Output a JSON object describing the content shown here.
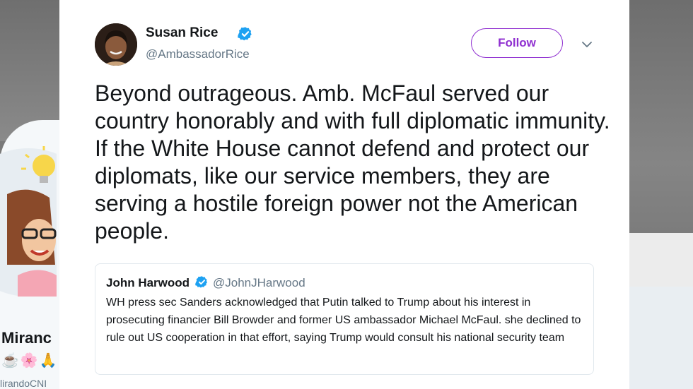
{
  "tweet": {
    "author_name": "Susan Rice",
    "author_handle": "@AmbassadorRice",
    "follow_label": "Follow",
    "text": "Beyond outrageous. Amb. McFaul served our country honorably and with full diplomatic immunity. If the White House cannot defend and protect our diplomats, like our service members, they are serving a hostile foreign power not the American people.",
    "verified_icon": "verified-badge",
    "menu_icon": "chevron-down"
  },
  "quoted_tweet": {
    "author_name": "John Harwood",
    "author_handle": "@JohnJHarwood",
    "text": "WH press sec Sanders acknowledged that Putin talked to Trump about his interest in prosecuting financier Bill Browder and former US ambassador Michael McFaul. she declined to rule out US cooperation in that effort, saying Trump would consult his national security team"
  },
  "background_profile": {
    "name_fragment": "Miranc",
    "emojis": "☕🌸🙏",
    "handle_fragment": "lirandoCNI"
  },
  "colors": {
    "follow_accent": "#8f2fd0",
    "verified_blue": "#1da1f2",
    "text_primary": "#14171a",
    "text_secondary": "#657786"
  }
}
